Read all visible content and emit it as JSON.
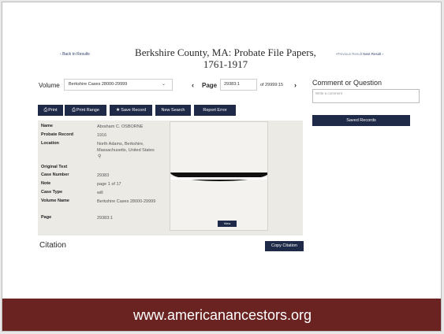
{
  "nav": {
    "back_label": "Back to Results",
    "previous_label": "Previous Result",
    "next_label": "Next Result"
  },
  "title": {
    "line1": "Berkshire County, MA: Probate File Papers,",
    "line2": "1761-1917"
  },
  "volume": {
    "label": "Volume",
    "selected": "Berkshire Cases 28000-29999"
  },
  "page_nav": {
    "label": "Page",
    "current": "29383:1",
    "of_text": "of 29999:15"
  },
  "comment": {
    "title": "Comment or Question",
    "placeholder": "Write a comment"
  },
  "saved_records_label": "Saved Records",
  "toolbar": {
    "print": "Print",
    "print_range": "Print Range",
    "save_record": "Save Record",
    "new_search": "New Search",
    "report_error": "Report Error"
  },
  "record": {
    "name_label": "Name",
    "name": "Abraham C. OSBORNE",
    "probate_label": "Probate Record",
    "probate": "1916",
    "location_label": "Location",
    "location": "North Adams, Berkshire, Massachusetts, United States",
    "original_text_label": "Original Text",
    "case_number_label": "Case Number",
    "case_number": "29383",
    "note_label": "Note",
    "note": "page 1 of 17",
    "case_type_label": "Case Type",
    "case_type": "will",
    "volume_name_label": "Volume Name",
    "volume_name": "Berkshire Cases 28000-29999",
    "page_label": "Page",
    "page": "29383:1"
  },
  "viewer": {
    "view_label": "View"
  },
  "citation": {
    "title": "Citation",
    "copy_label": "Copy Citation"
  },
  "footer": {
    "url": "www.americanancestors.org"
  },
  "colors": {
    "navy": "#1f2a48",
    "footer_bg": "#6b2322",
    "panel_bg": "#eceae5"
  }
}
